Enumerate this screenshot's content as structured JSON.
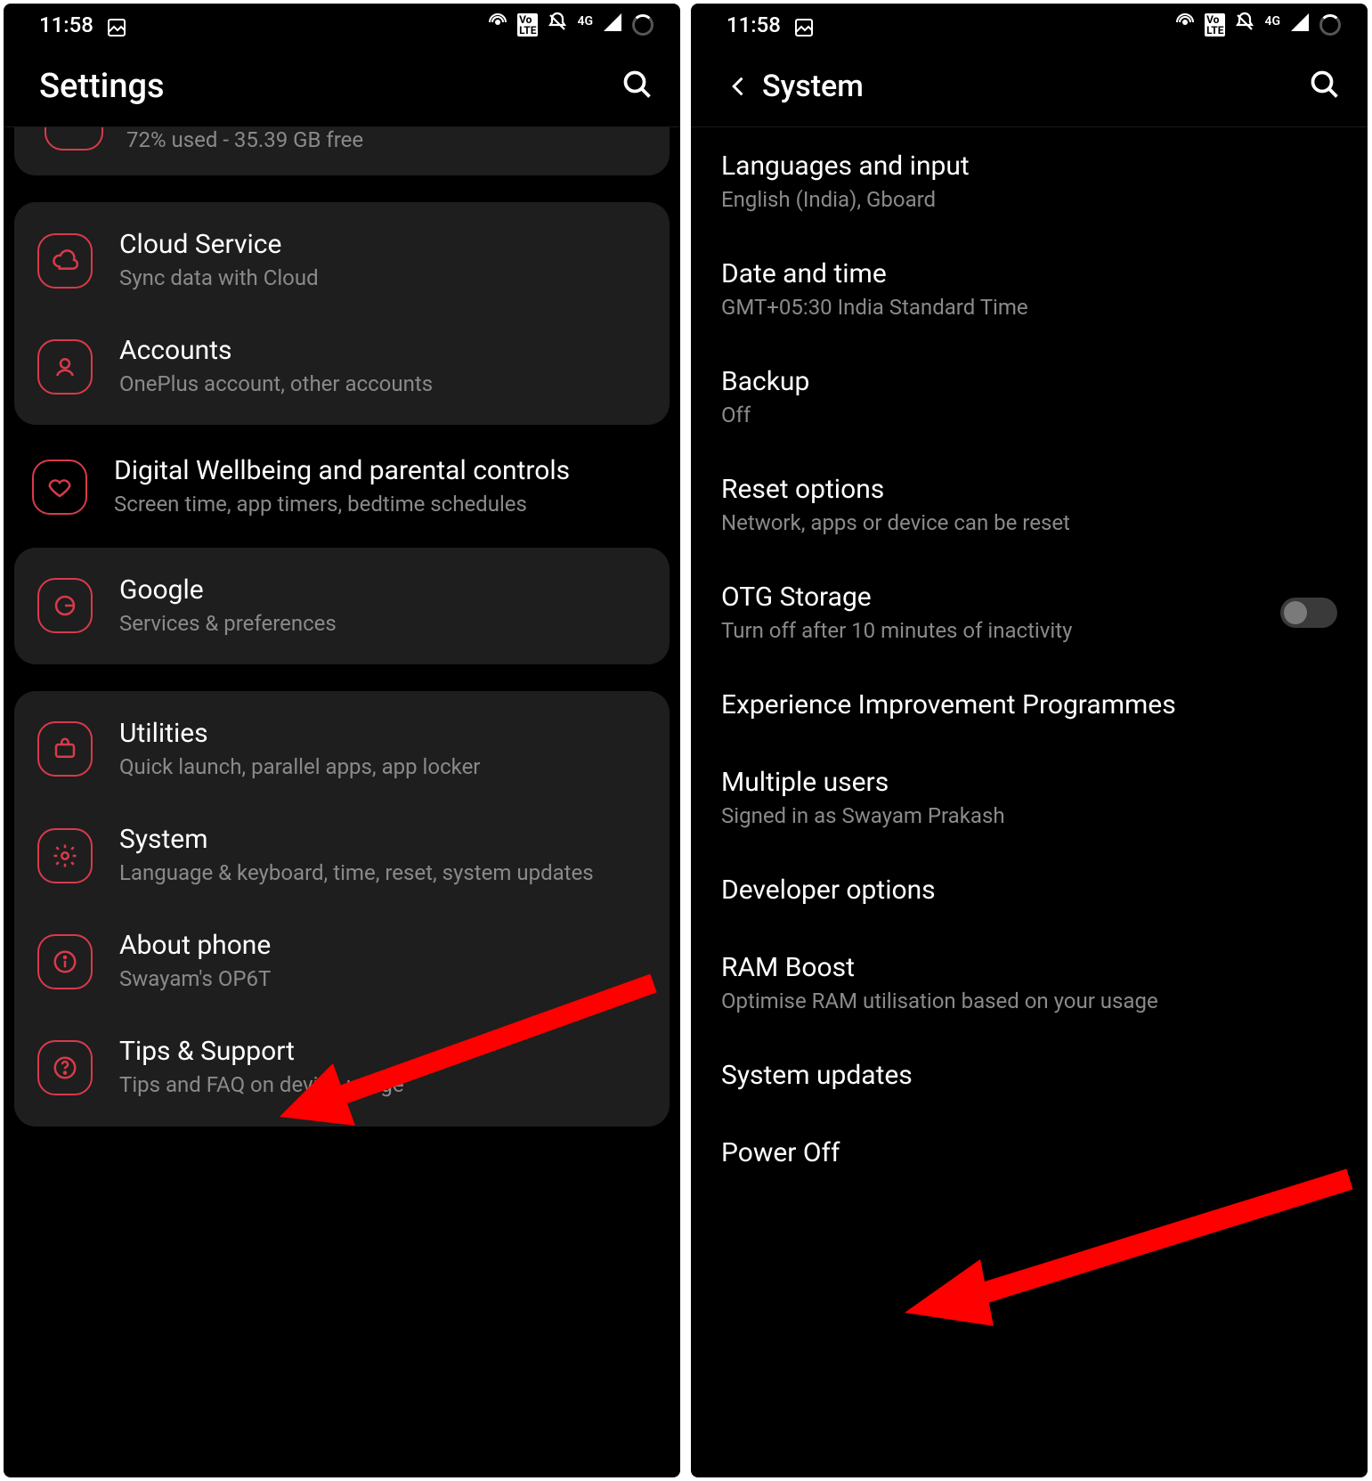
{
  "statusbar": {
    "time": "11:58",
    "net_label": "4G"
  },
  "left": {
    "title": "Settings",
    "storage_partial": "72% used - 35.39 GB free",
    "group1": [
      {
        "label": "Cloud Service",
        "sub": "Sync data with Cloud"
      },
      {
        "label": "Accounts",
        "sub": "OnePlus account, other accounts"
      }
    ],
    "wellbeing": {
      "label": "Digital Wellbeing and parental controls",
      "sub": "Screen time, app timers, bedtime schedules"
    },
    "google": {
      "label": "Google",
      "sub": "Services & preferences"
    },
    "group3": [
      {
        "label": "Utilities",
        "sub": "Quick launch, parallel apps, app locker"
      },
      {
        "label": "System",
        "sub": "Language & keyboard, time, reset, system updates"
      },
      {
        "label": "About phone",
        "sub": "Swayam's OP6T"
      },
      {
        "label": "Tips & Support",
        "sub": "Tips and FAQ on device usage"
      }
    ]
  },
  "right": {
    "title": "System",
    "rows": [
      {
        "label": "Languages and input",
        "sub": "English (India), Gboard"
      },
      {
        "label": "Date and time",
        "sub": "GMT+05:30 India Standard Time"
      },
      {
        "label": "Backup",
        "sub": "Off"
      },
      {
        "label": "Reset options",
        "sub": "Network, apps or device can be reset"
      },
      {
        "label": "OTG Storage",
        "sub": "Turn off after 10 minutes of inactivity",
        "toggle": true
      },
      {
        "label": "Experience Improvement Programmes",
        "sub": ""
      },
      {
        "label": "Multiple users",
        "sub": "Signed in as Swayam Prakash"
      },
      {
        "label": "Developer options",
        "sub": ""
      },
      {
        "label": "RAM Boost",
        "sub": "Optimise RAM utilisation based on your usage"
      },
      {
        "label": "System updates",
        "sub": ""
      },
      {
        "label": "Power Off",
        "sub": ""
      }
    ]
  }
}
